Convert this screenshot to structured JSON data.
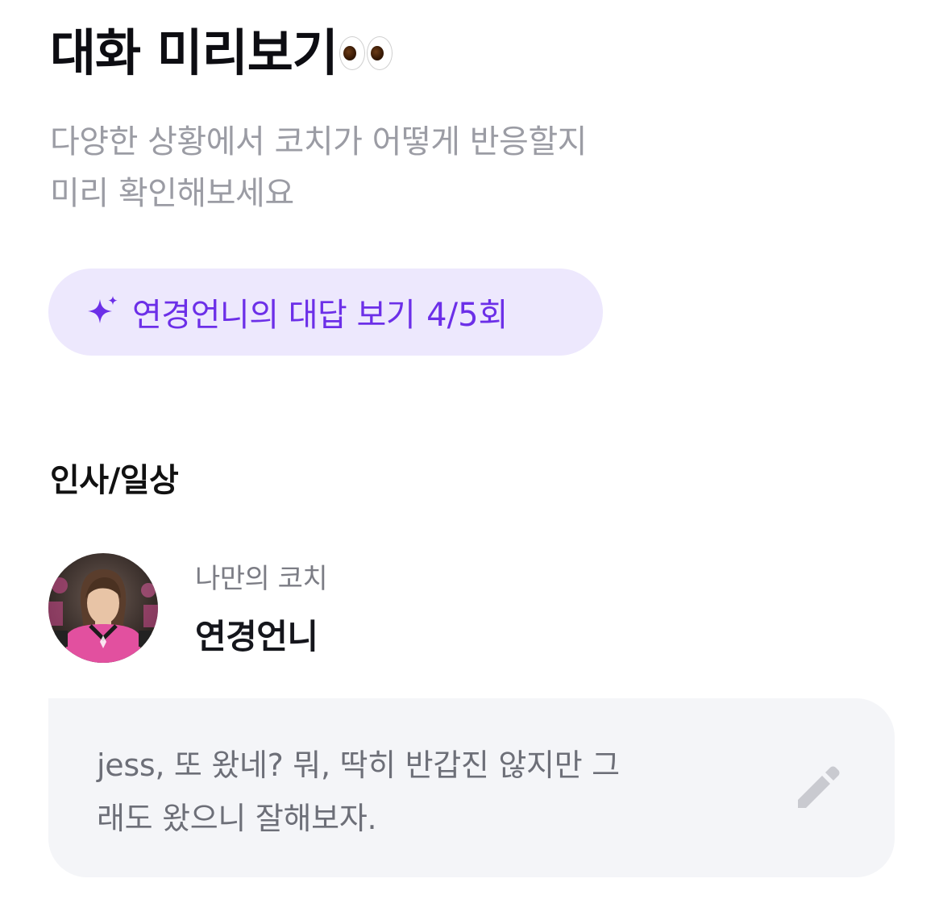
{
  "header": {
    "title": "대화 미리보기",
    "title_emoji": "eyes-emoji-icon",
    "subtitle_lines": [
      "다양한 상황에서 코치가 어떻게 반응할지",
      "미리 확인해보세요"
    ]
  },
  "preview_button": {
    "icon": "sparkle-icon",
    "label": "연경언니의 대답 보기",
    "count": "4/5회"
  },
  "section": {
    "title": "인사/일상"
  },
  "coach": {
    "avatar_icon": "coach-avatar",
    "caption": "나만의 코치",
    "name": "연경언니"
  },
  "message": {
    "lines": [
      "jess, 또 왔네? 뭐, 딱히 반갑진 않지만 그",
      "래도 왔으니 잘해보자."
    ],
    "edit_icon": "pencil-icon"
  },
  "colors": {
    "accent": "#6c2fe8",
    "chip_background": "#ede8fd",
    "card_background": "#f4f5f8",
    "subtitle": "#9b9ca4"
  }
}
